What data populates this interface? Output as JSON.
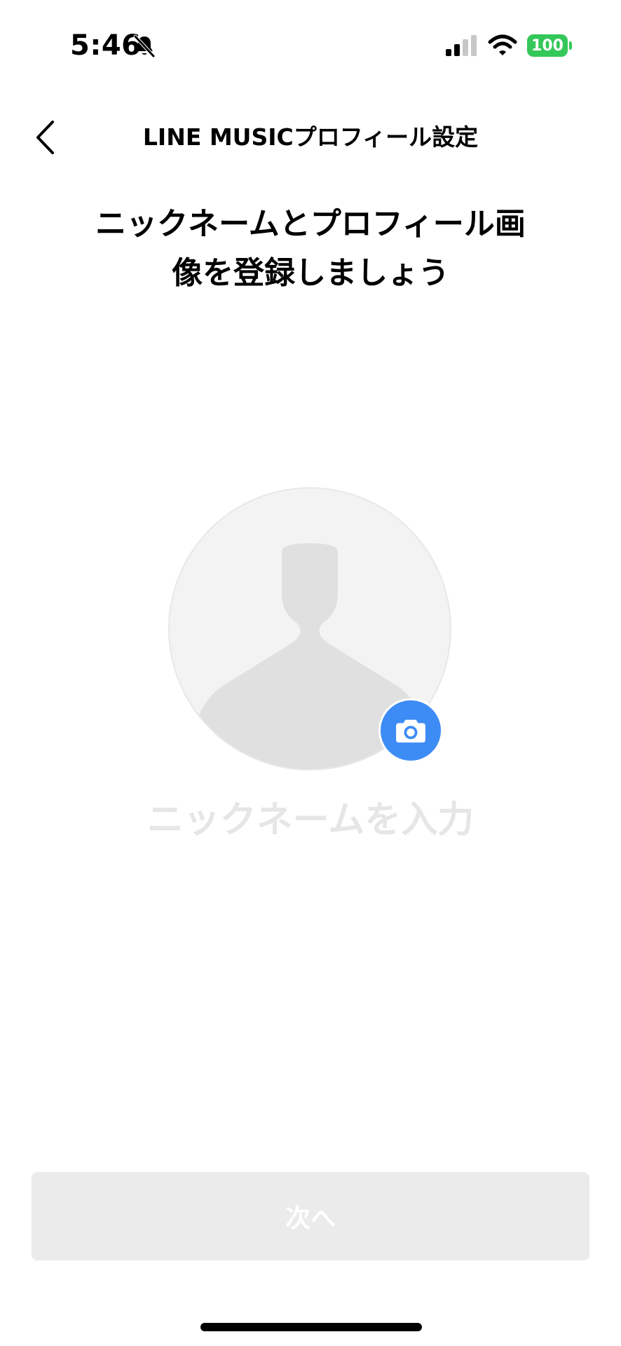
{
  "status_bar": {
    "time": "5:46",
    "battery": "100",
    "battery_color": "#34c759",
    "icons": [
      "bell-slash-icon",
      "cellular-signal-icon",
      "wifi-icon",
      "battery-icon"
    ]
  },
  "nav": {
    "back_icon": "chevron-left-icon",
    "title": "LINE MUSICプロフィール設定"
  },
  "heading": {
    "line1": "ニックネームとプロフィール画",
    "line2": "像を登録しましょう"
  },
  "avatar": {
    "icon": "person-silhouette-icon",
    "camera_icon": "camera-icon",
    "camera_button_color": "#3d8cf5"
  },
  "nickname": {
    "value": "",
    "placeholder": "ニックネームを入力"
  },
  "next_button": {
    "label": "次へ",
    "enabled": false
  }
}
